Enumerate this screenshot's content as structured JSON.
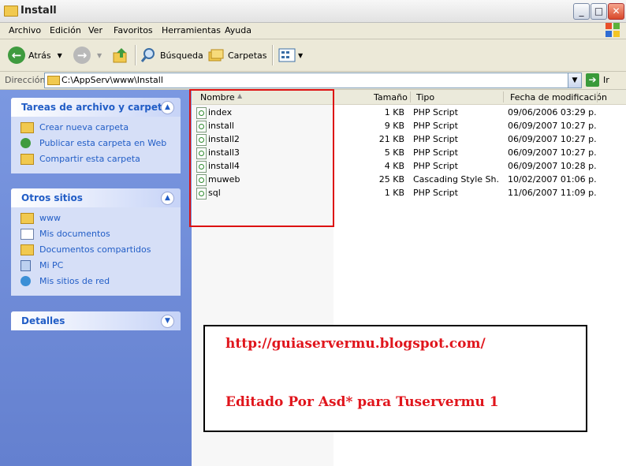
{
  "window": {
    "title": "Install",
    "controls": {
      "minimize": "_",
      "maximize": "□",
      "close": "✕"
    }
  },
  "menu": [
    "Archivo",
    "Edición",
    "Ver",
    "Favoritos",
    "Herramientas",
    "Ayuda"
  ],
  "toolbar": {
    "back": "Atrás",
    "search": "Búsqueda",
    "folders": "Carpetas"
  },
  "address": {
    "label": "Dirección",
    "path": "C:\\AppServ\\www\\Install",
    "go": "Ir"
  },
  "tasks_panel": {
    "title": "Tareas de archivo y carpeta",
    "items": [
      {
        "label": "Crear nueva carpeta",
        "icon": "new-folder-icon"
      },
      {
        "label": "Publicar esta carpeta en Web",
        "icon": "web-publish-icon"
      },
      {
        "label": "Compartir esta carpeta",
        "icon": "share-folder-icon"
      }
    ]
  },
  "places_panel": {
    "title": "Otros sitios",
    "items": [
      {
        "label": "www",
        "icon": "folder-icon"
      },
      {
        "label": "Mis documentos",
        "icon": "documents-icon"
      },
      {
        "label": "Documentos compartidos",
        "icon": "folder-icon"
      },
      {
        "label": "Mi PC",
        "icon": "computer-icon"
      },
      {
        "label": "Mis sitios de red",
        "icon": "network-icon"
      }
    ]
  },
  "details_panel": {
    "title": "Detalles"
  },
  "columns": {
    "name": "Nombre",
    "size": "Tamaño",
    "type": "Tipo",
    "date": "Fecha de modificación"
  },
  "files": [
    {
      "name": "index",
      "size": "1 KB",
      "type": "PHP Script",
      "date": "09/06/2006 03:29 p..."
    },
    {
      "name": "install",
      "size": "9 KB",
      "type": "PHP Script",
      "date": "06/09/2007 10:27 p..."
    },
    {
      "name": "install2",
      "size": "21 KB",
      "type": "PHP Script",
      "date": "06/09/2007 10:27 p..."
    },
    {
      "name": "install3",
      "size": "5 KB",
      "type": "PHP Script",
      "date": "06/09/2007 10:27 p..."
    },
    {
      "name": "install4",
      "size": "4 KB",
      "type": "PHP Script",
      "date": "06/09/2007 10:28 p..."
    },
    {
      "name": "muweb",
      "size": "25 KB",
      "type": "Cascading Style Sh...",
      "date": "10/02/2007 01:06 p..."
    },
    {
      "name": "sql",
      "size": "1 KB",
      "type": "PHP Script",
      "date": "11/06/2007 11:09 p..."
    }
  ],
  "note": {
    "line1": "http://guiaservermu.blogspot.com/",
    "line2": "Editado Por Asd*  para Tuservermu 1"
  },
  "colors": {
    "annotation": "#e0151c",
    "link_blue": "#215dc6",
    "task_pane": "#6480cf"
  }
}
